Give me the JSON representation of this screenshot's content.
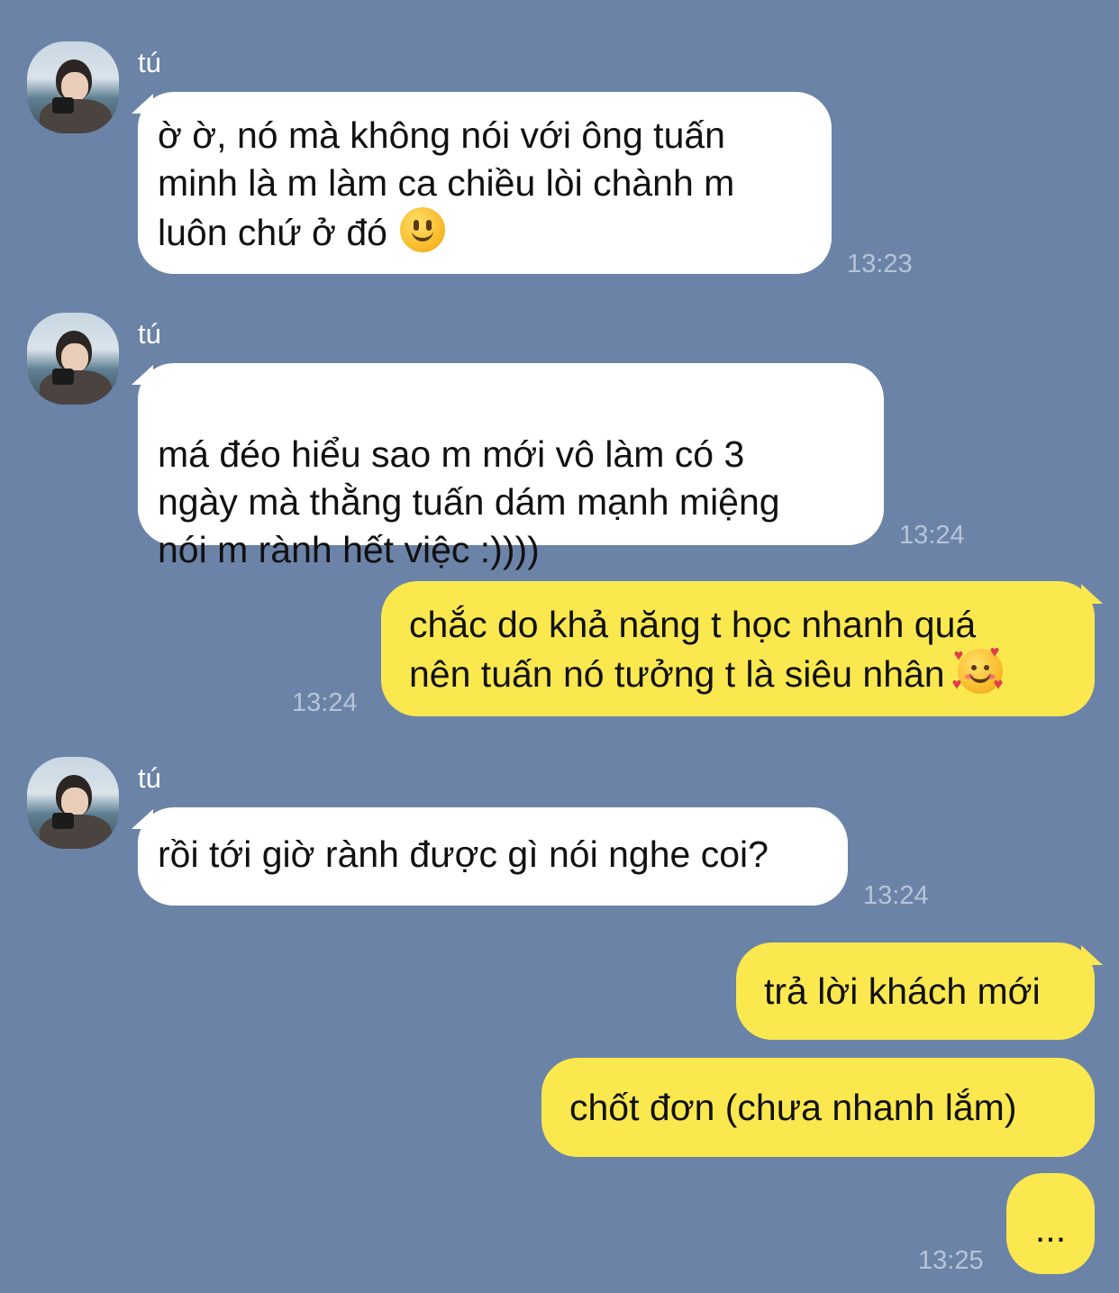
{
  "messages": [
    {
      "sender": "tú",
      "text": "ờ ờ, nó mà không nói với ông tuấn\nminh là m làm ca chiều lòi chành m\nluôn chứ ở đó",
      "emoji": "slightly-smiling-face",
      "time": "13:23"
    },
    {
      "sender": "tú",
      "text": "má đéo hiểu sao m mới vô làm có 3\nngày mà thằng tuấn dám mạnh miệng\nnói m rành hết việc :))))",
      "time": "13:24"
    },
    {
      "sender": "me",
      "text": "chắc do khả năng t học nhanh quá\nnên tuấn nó tưởng t là siêu nhân",
      "emoji": "smiling-face-with-hearts",
      "time": "13:24"
    },
    {
      "sender": "tú",
      "text": "rồi tới giờ rành được gì nói nghe coi?",
      "time": "13:24"
    },
    {
      "sender": "me",
      "text": "trả lời khách mới"
    },
    {
      "sender": "me",
      "text": "chốt đơn (chưa nhanh lắm)"
    },
    {
      "sender": "me",
      "text": "...",
      "time": "13:25"
    }
  ],
  "colors": {
    "background": "#6c83a8",
    "incoming": "#ffffff",
    "outgoing": "#fae84e",
    "time": "#b6c4d8"
  }
}
